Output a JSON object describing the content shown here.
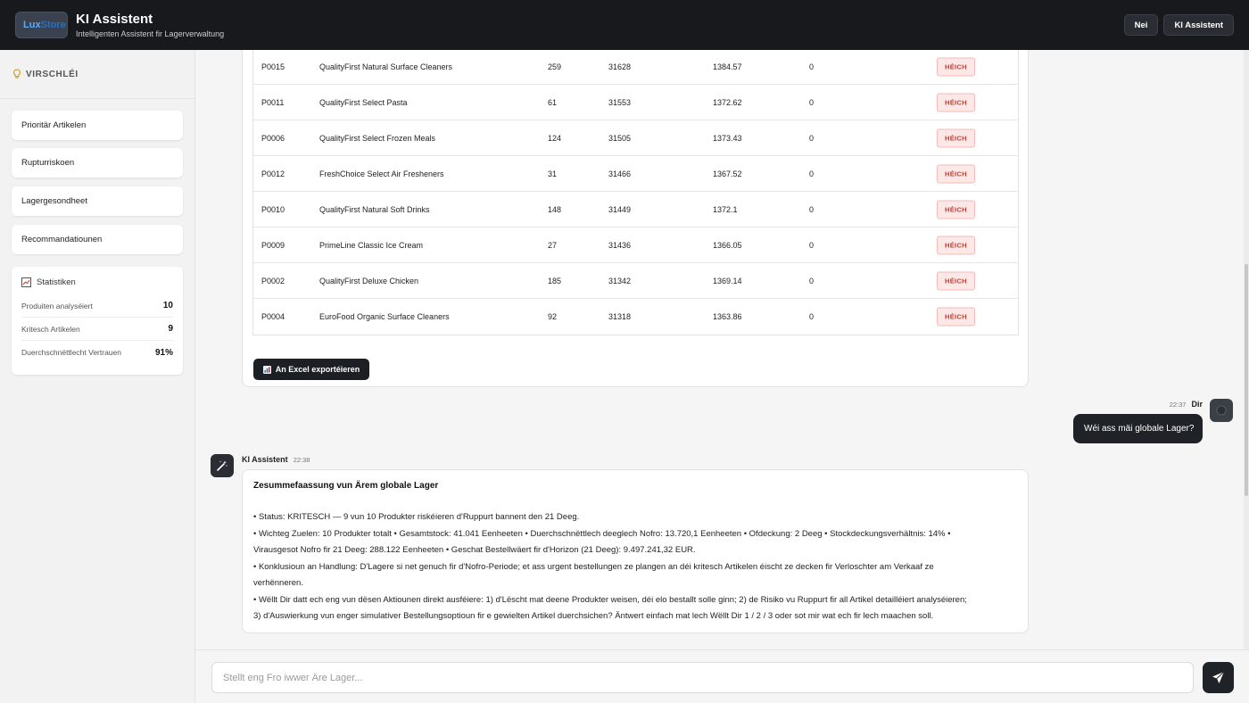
{
  "header": {
    "logo_part1": "Lux",
    "logo_part2": "Store",
    "title": "KI Assistent",
    "subtitle": "Intelligenten Assistent fir Lagerverwaltung",
    "btn_new": "Nei",
    "btn_assistant": "KI Assistent"
  },
  "sidebar": {
    "suggestions_title": "VIRSCHLÉI",
    "suggestions": [
      "Prioritär Artikelen",
      "Rupturriskoen",
      "Lagergesondheet",
      "Recommandatiounen"
    ],
    "stats_title": "Statistiken",
    "stats": [
      {
        "label": "Produiten analyséiert",
        "value": "10"
      },
      {
        "label": "Kritesch Artikelen",
        "value": "9"
      },
      {
        "label": "Duerchschnëttlecht Vertrauen",
        "value": "91%"
      }
    ]
  },
  "table": {
    "rows": [
      [
        "P0015",
        "QualityFirst Natural Surface Cleaners",
        "259",
        "31628",
        "1384.57",
        "0",
        "HÉICH"
      ],
      [
        "P0011",
        "QualityFirst Select Pasta",
        "61",
        "31553",
        "1372.62",
        "0",
        "HÉICH"
      ],
      [
        "P0006",
        "QualityFirst Select Frozen Meals",
        "124",
        "31505",
        "1373.43",
        "0",
        "HÉICH"
      ],
      [
        "P0012",
        "FreshChoice Select Air Fresheners",
        "31",
        "31466",
        "1367.52",
        "0",
        "HÉICH"
      ],
      [
        "P0010",
        "QualityFirst Natural Soft Drinks",
        "148",
        "31449",
        "1372.1",
        "0",
        "HÉICH"
      ],
      [
        "P0009",
        "PrimeLine Classic Ice Cream",
        "27",
        "31436",
        "1366.05",
        "0",
        "HÉICH"
      ],
      [
        "P0002",
        "QualityFirst Deluxe Chicken",
        "185",
        "31342",
        "1369.14",
        "0",
        "HÉICH"
      ],
      [
        "P0004",
        "EuroFood Organic Surface Cleaners",
        "92",
        "31318",
        "1363.86",
        "0",
        "HÉICH"
      ]
    ],
    "export_label": "An Excel exportéieren"
  },
  "chat": {
    "user_time": "22:37",
    "user_name": "Dir",
    "user_message": "Wéi ass mäi globale Lager?",
    "ai_name": "KI Assistent",
    "ai_time": "22:38",
    "ai_heading": "Zesummefaassung vun Ärem globale Lager",
    "ai_lines": [
      "• Status: KRITESCH — 9 vun 10 Produkter riskéieren d'Ruppurt bannent den 21 Deeg.",
      "• Wichteg Zuelen: 10 Produkter totalt • Gesamtstock: 41.041 Eenheeten • Duerchschnëttlech deeglech Nofro: 13.720,1 Eenheeten • Ofdeckung: 2 Deeg • Stockdeckungsverhältnis: 14% •",
      "Virausgesot Nofro fir 21 Deeg: 288.122 Eenheeten • Geschat Bestellwäert fir d'Horizon (21 Deeg): 9.497.241,32 EUR.",
      "• Konklusioun an Handlung: D'Lagere si net genuch fir d'Nofro-Periode; et ass urgent bestellungen ze plangen an déi kritesch Artikelen éischt ze decken fir Verloschter am Verkaaf ze",
      "verhënneren.",
      "• Wëllt Dir datt ech eng vun dësen Aktiounen direkt ausféiere: 1) d'Lëscht mat deene Produkter weisen, déi elo bestallt solle ginn; 2) de Risiko vu Ruppurt fir all Artikel detailléiert analyséieren;",
      "3) d'Auswierkung vun enger simulativer Bestellungsoptioun fir e gewielten Artikel duerchsichen? Äntwert einfach mat lech Wëllt Dir 1 / 2 / 3 oder sot mir wat ech fir lech maachen soll."
    ]
  },
  "composer": {
    "placeholder": "Stellt eng Fro iwwer Äre Lager..."
  }
}
